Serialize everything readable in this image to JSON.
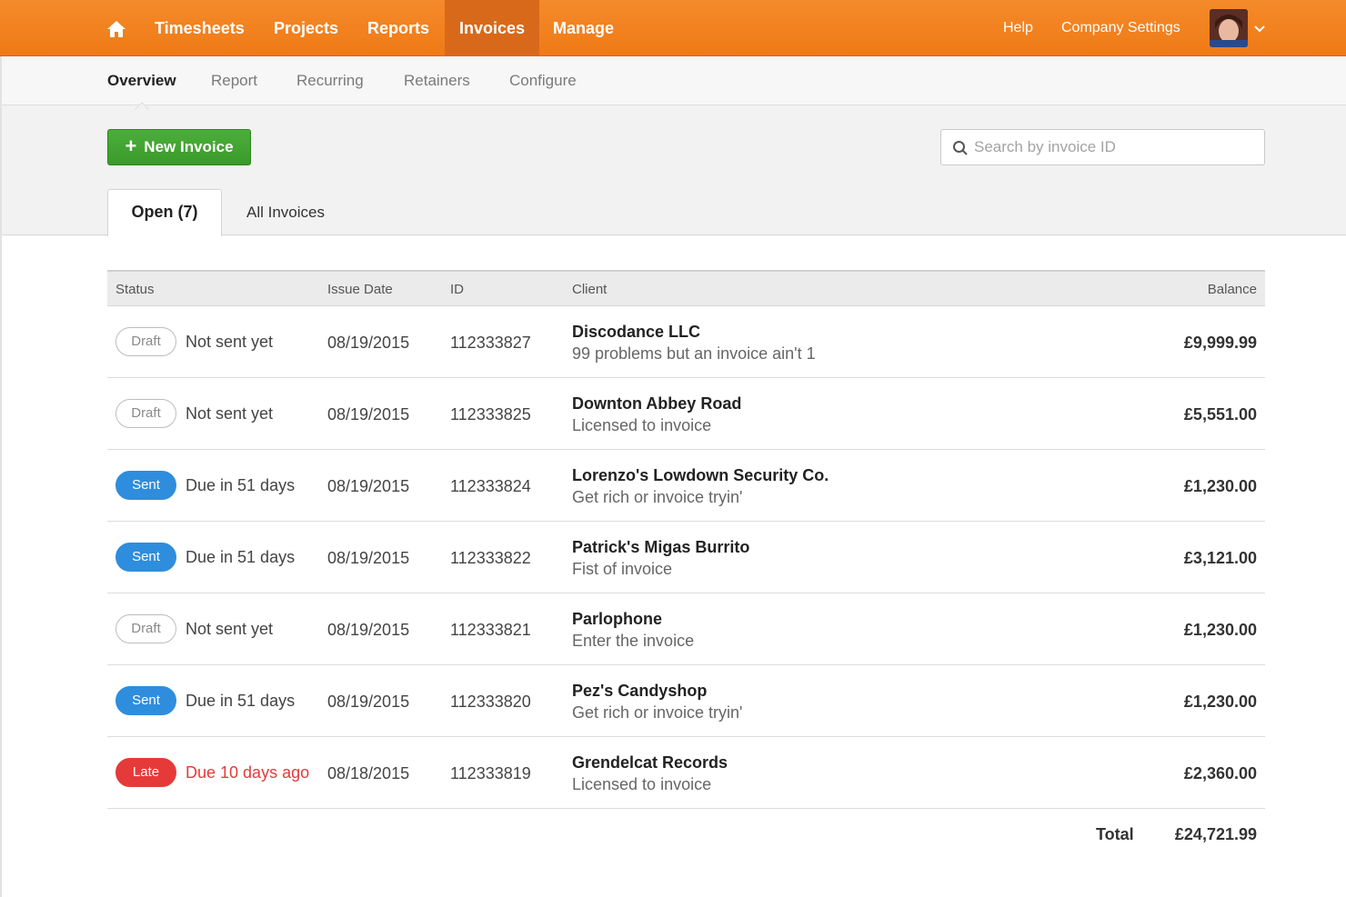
{
  "topnav": {
    "items": [
      {
        "label": "Timesheets"
      },
      {
        "label": "Projects"
      },
      {
        "label": "Reports"
      },
      {
        "label": "Invoices"
      },
      {
        "label": "Manage"
      }
    ],
    "help": "Help",
    "company_settings": "Company Settings"
  },
  "subnav": {
    "items": [
      {
        "label": "Overview"
      },
      {
        "label": "Report"
      },
      {
        "label": "Recurring"
      },
      {
        "label": "Retainers"
      },
      {
        "label": "Configure"
      }
    ]
  },
  "toolbar": {
    "new_invoice_label": "New Invoice",
    "search_placeholder": "Search by invoice ID"
  },
  "tabs": {
    "open": "Open (7)",
    "all": "All Invoices"
  },
  "table": {
    "headers": {
      "status": "Status",
      "issue_date": "Issue Date",
      "id": "ID",
      "client": "Client",
      "balance": "Balance"
    },
    "rows": [
      {
        "badge": "Draft",
        "badge_type": "draft",
        "due": "Not sent yet",
        "date": "08/19/2015",
        "id": "112333827",
        "client": "Discodance LLC",
        "desc": "99 problems but an invoice ain't 1",
        "balance": "£9,999.99"
      },
      {
        "badge": "Draft",
        "badge_type": "draft",
        "due": "Not sent yet",
        "date": "08/19/2015",
        "id": "112333825",
        "client": "Downton Abbey Road",
        "desc": "Licensed to invoice",
        "balance": "£5,551.00"
      },
      {
        "badge": "Sent",
        "badge_type": "sent",
        "due": "Due in 51 days",
        "date": "08/19/2015",
        "id": "112333824",
        "client": "Lorenzo's Lowdown Security Co.",
        "desc": "Get rich or invoice tryin'",
        "balance": "£1,230.00"
      },
      {
        "badge": "Sent",
        "badge_type": "sent",
        "due": "Due in 51 days",
        "date": "08/19/2015",
        "id": "112333822",
        "client": "Patrick's Migas Burrito",
        "desc": "Fist of invoice",
        "balance": "£3,121.00"
      },
      {
        "badge": "Draft",
        "badge_type": "draft",
        "due": "Not sent yet",
        "date": "08/19/2015",
        "id": "112333821",
        "client": "Parlophone",
        "desc": "Enter the invoice",
        "balance": "£1,230.00"
      },
      {
        "badge": "Sent",
        "badge_type": "sent",
        "due": "Due in 51 days",
        "date": "08/19/2015",
        "id": "112333820",
        "client": "Pez's Candyshop",
        "desc": "Get rich or invoice tryin'",
        "balance": "£1,230.00"
      },
      {
        "badge": "Late",
        "badge_type": "late",
        "due": "Due 10 days ago",
        "date": "08/18/2015",
        "id": "112333819",
        "client": "Grendelcat Records",
        "desc": "Licensed to invoice",
        "balance": "£2,360.00"
      }
    ],
    "total_label": "Total",
    "total_value": "£24,721.99"
  },
  "colors": {
    "brand_orange": "#ef7a16",
    "button_green": "#3a9a2a",
    "sent_blue": "#2f8ddd",
    "late_red": "#e63a3a"
  },
  "icons": {
    "home": "home-icon",
    "search": "search-icon",
    "chevron": "chevron-down-icon",
    "plus": "plus-icon"
  }
}
